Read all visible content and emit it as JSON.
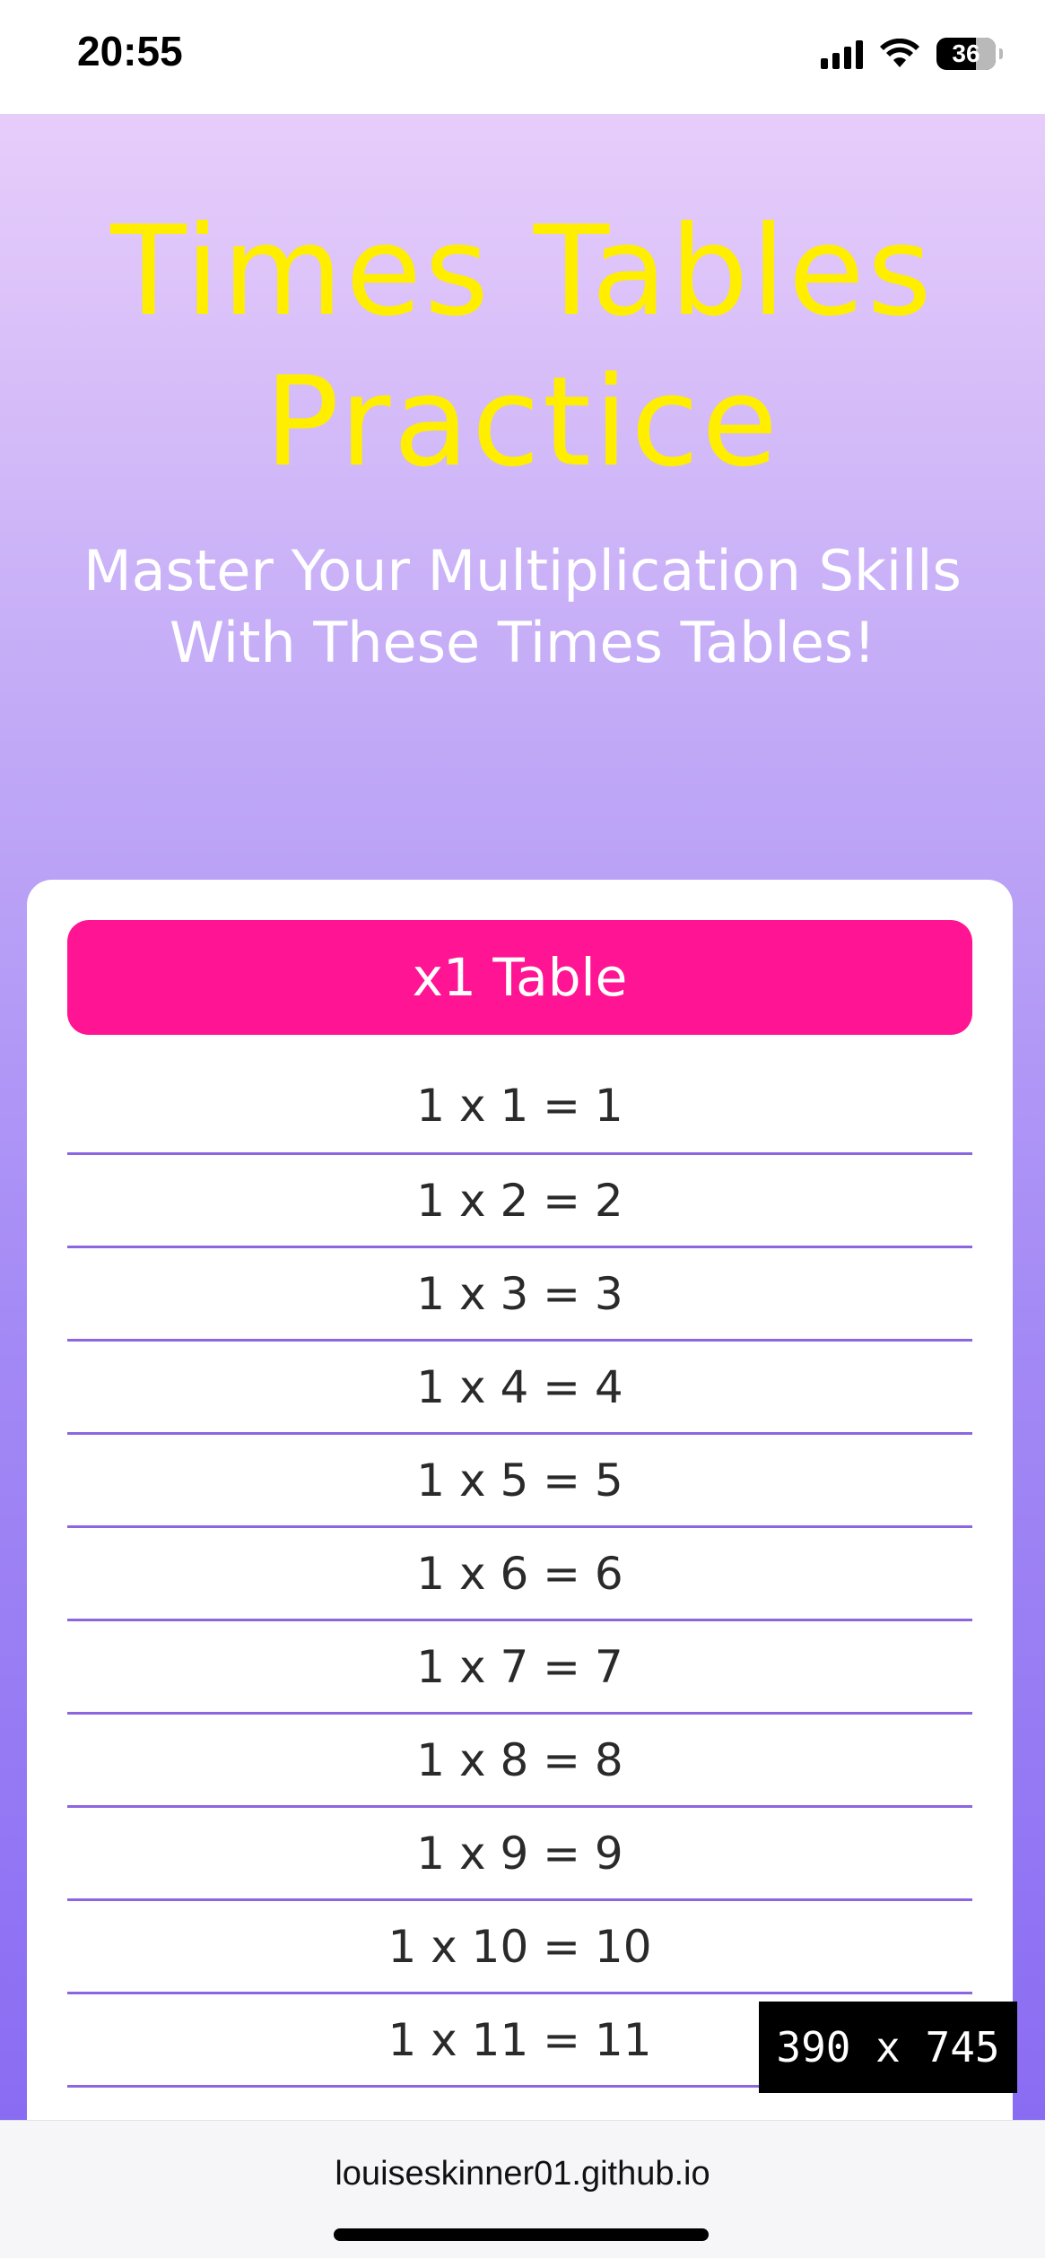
{
  "status_bar": {
    "time": "20:55",
    "battery": "36",
    "icons": [
      "signal-icon",
      "wifi-icon",
      "battery-icon"
    ]
  },
  "page": {
    "title": "Times Tables Practice",
    "subtitle": "Master Your Multiplication Skills With These Times Tables!"
  },
  "table": {
    "header": "x1 Table",
    "rows": [
      "1 x 1 = 1",
      "1 x 2 = 2",
      "1 x 3 = 3",
      "1 x 4 = 4",
      "1 x 5 = 5",
      "1 x 6 = 6",
      "1 x 7 = 7",
      "1 x 8 = 8",
      "1 x 9 = 9",
      "1 x 10 = 10",
      "1 x 11 = 11"
    ]
  },
  "viewport_badge": "390 x 745",
  "browser": {
    "url": "louiseskinner01.github.io"
  },
  "colors": {
    "title": "#ffee00",
    "header_button": "#ff1493",
    "row_divider": "#8b66e0",
    "gradient_top": "#e7cdfa",
    "gradient_bottom": "#8a6cf3"
  }
}
